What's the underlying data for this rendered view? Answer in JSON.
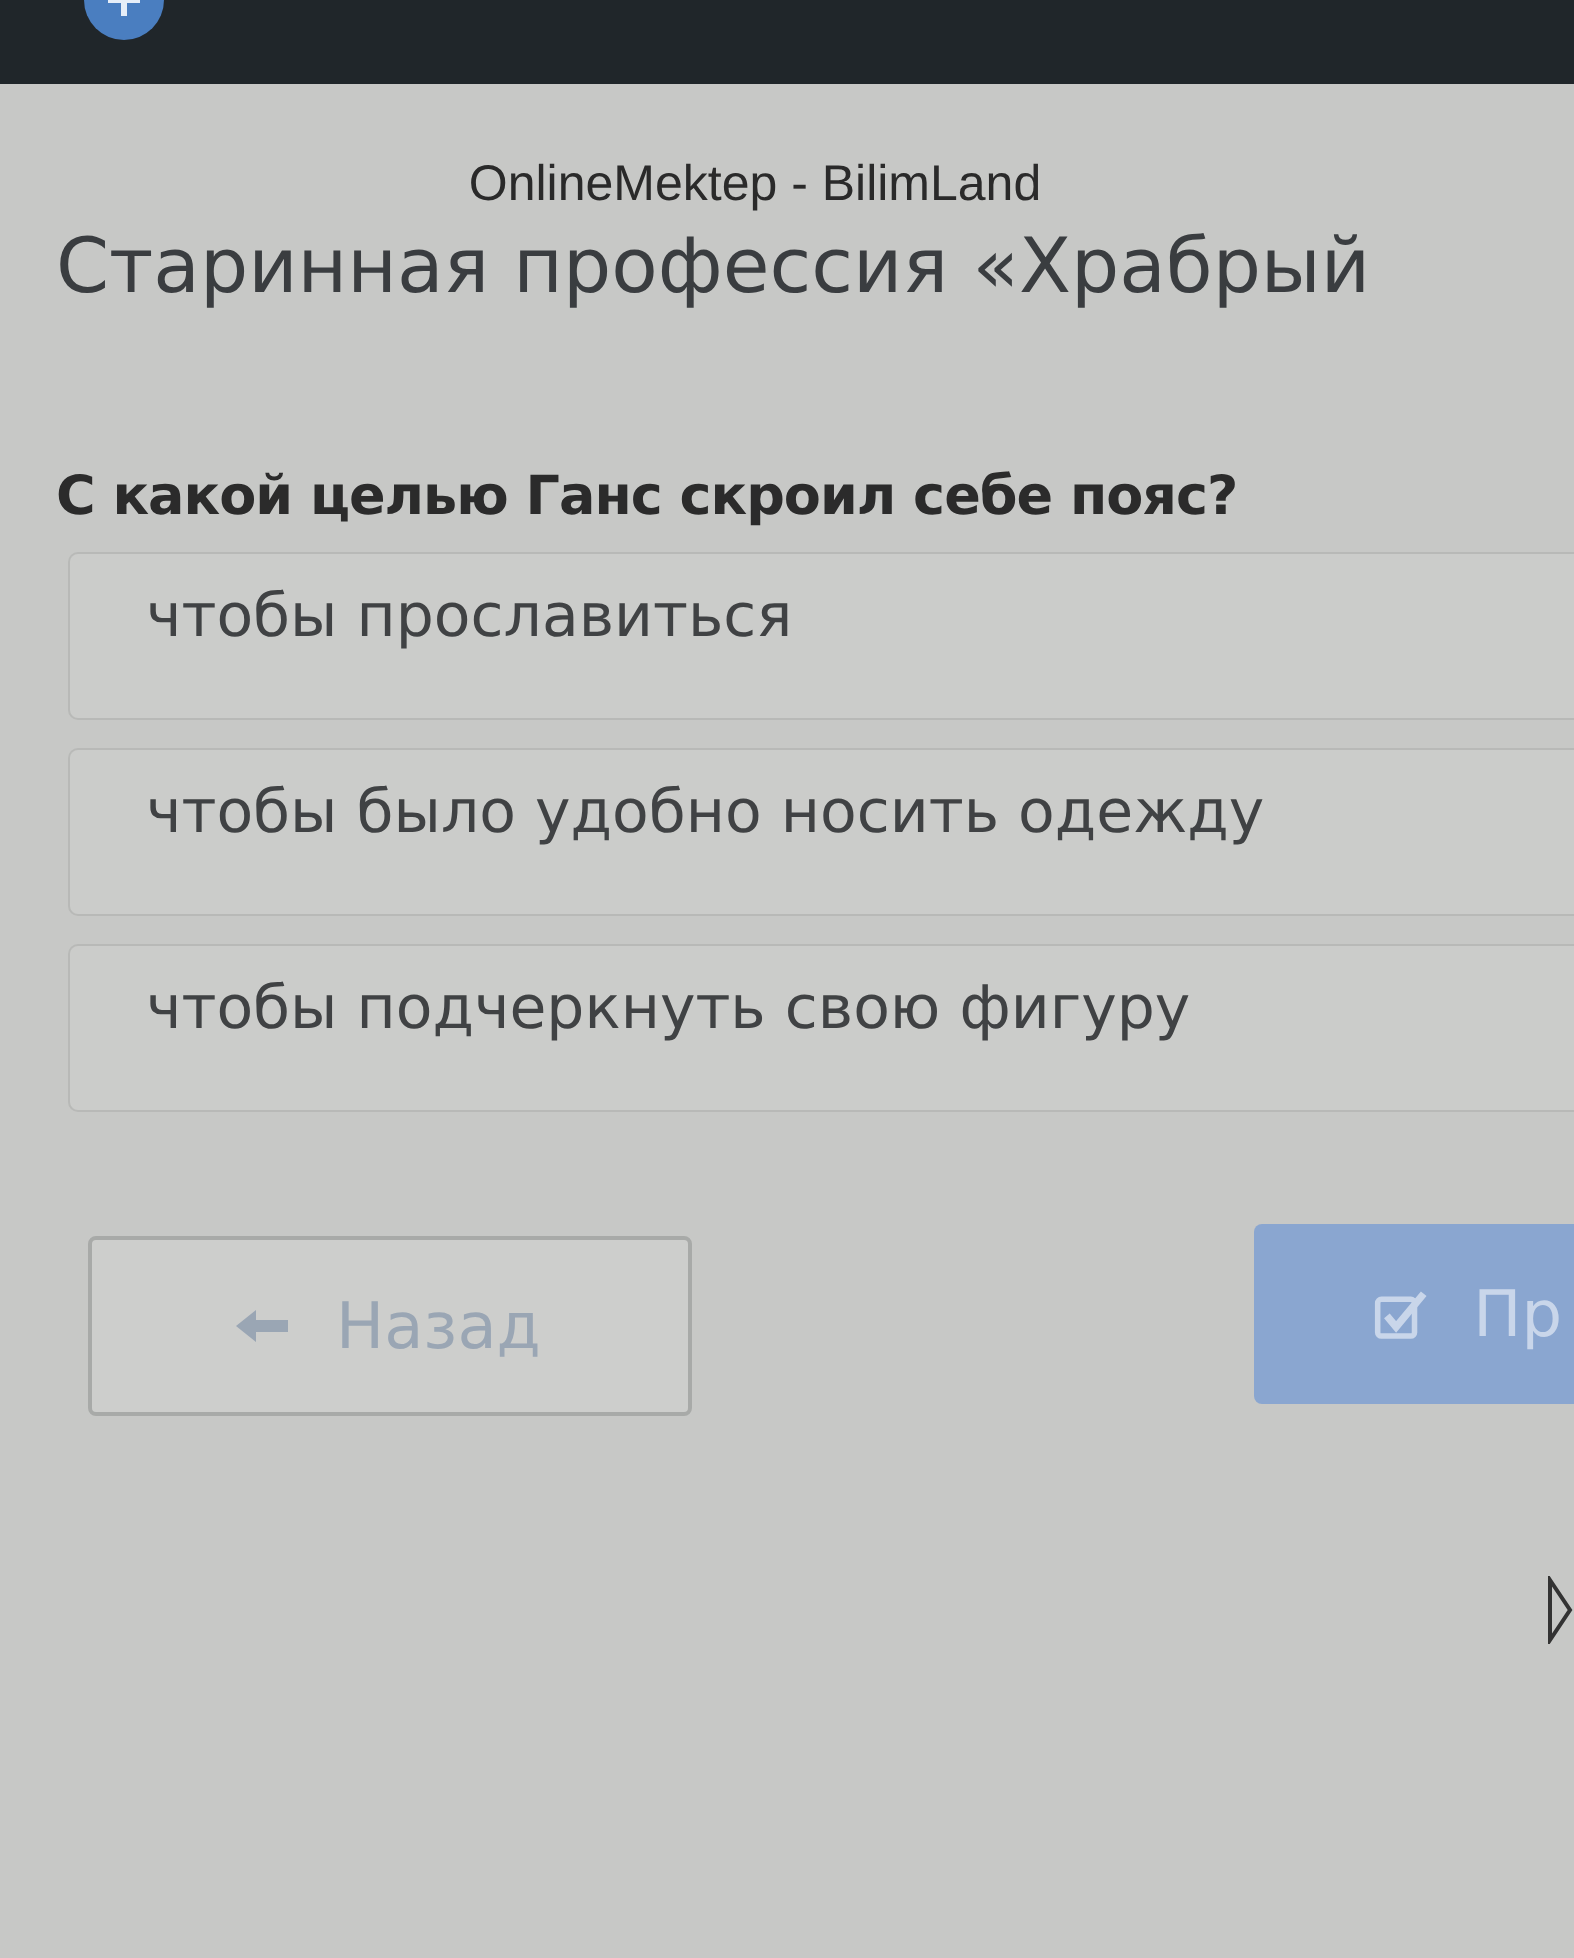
{
  "window": {
    "title": "OnlineMektep - BilimLand"
  },
  "lesson": {
    "title": "Старинная профессия «Храбрый"
  },
  "question": {
    "text": "С какой целью Ганс скроил себе пояс?"
  },
  "options": [
    {
      "label": "чтобы прославиться",
      "selected": false
    },
    {
      "label": "чтобы было удобно носить одежду",
      "selected": false
    },
    {
      "label": "чтобы подчеркнуть свою фигуру",
      "selected": false
    }
  ],
  "buttons": [
    {
      "kind": "back",
      "label": "Назад",
      "disabled": true
    },
    {
      "kind": "submit",
      "label": "Пр",
      "disabled": true
    }
  ]
}
